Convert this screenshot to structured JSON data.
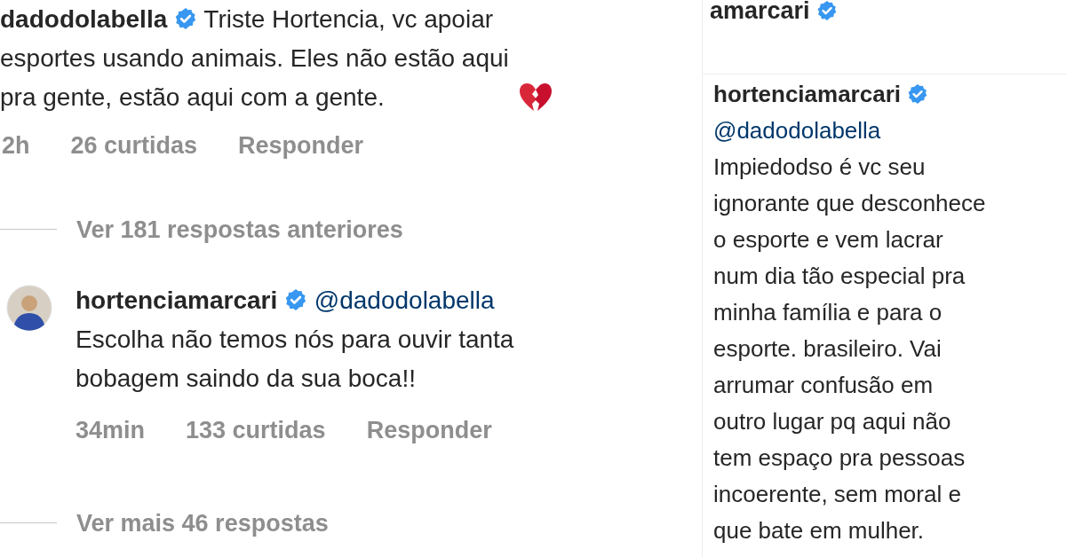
{
  "left_panel": {
    "comment": {
      "username": "dadodolabella",
      "verified": true,
      "text": "Triste Hortencia, vc apoiar\nesportes usando animais. Eles não estão aqui\npra gente, estão aqui com a gente.",
      "broken_heart_emoji": true,
      "time": "2h",
      "likes": "26 curtidas",
      "reply": "Responder"
    },
    "previous_replies": "Ver 181 respostas anteriores",
    "reply_comment": {
      "username": "hortenciamarcari",
      "verified": true,
      "mention": "@dadodolabella",
      "text": "Escolha não temos nós para ouvir tanta\nbobagem saindo da sua boca!!",
      "time": "34min",
      "likes": "133 curtidas",
      "reply": "Responder"
    },
    "more_replies": "Ver mais 46 respostas"
  },
  "right_panel": {
    "header": {
      "username": "amarcari",
      "verified": true
    },
    "comment": {
      "username": "hortenciamarcari",
      "verified": true,
      "mention": "@dadodolabella",
      "text": "Impiedodso é vc seu\nignorante que desconhece\no esporte e vem lacrar\nnum dia tão especial pra\nminha família e para o\nesporte. brasileiro. Vai\narrumar confusão em\noutro lugar pq aqui não\ntem espaço pra pessoas\nincoerente, sem moral e\nque bate em mulher."
    }
  }
}
